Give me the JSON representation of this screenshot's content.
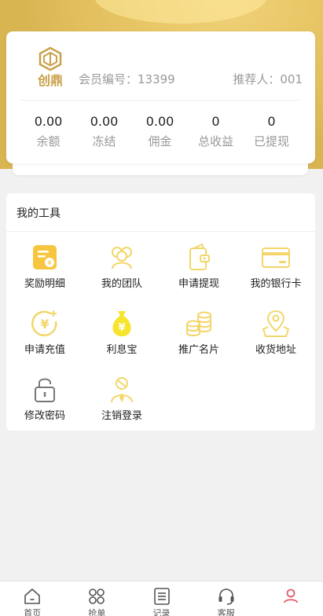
{
  "profile": {
    "logo_text": "创鼎",
    "member_id": "会员编号：13399",
    "referrer": "推荐人：001",
    "stats": [
      {
        "value": "0.00",
        "label": "余额"
      },
      {
        "value": "0.00",
        "label": "冻结"
      },
      {
        "value": "0.00",
        "label": "佣金"
      },
      {
        "value": "0",
        "label": "总收益"
      },
      {
        "value": "0",
        "label": "已提现"
      }
    ]
  },
  "tools": {
    "title": "我的工具",
    "items": [
      {
        "label": "奖励明细",
        "icon": "reward-detail-icon"
      },
      {
        "label": "我的团队",
        "icon": "team-icon"
      },
      {
        "label": "申请提现",
        "icon": "withdraw-wallet-icon"
      },
      {
        "label": "我的银行卡",
        "icon": "bank-card-icon"
      },
      {
        "label": "申请充值",
        "icon": "recharge-yen-icon"
      },
      {
        "label": "利息宝",
        "icon": "money-bag-icon"
      },
      {
        "label": "推广名片",
        "icon": "coins-stack-icon"
      },
      {
        "label": "收货地址",
        "icon": "map-pin-icon"
      },
      {
        "label": "修改密码",
        "icon": "padlock-icon"
      },
      {
        "label": "注销登录",
        "icon": "logout-user-icon"
      }
    ]
  },
  "tabbar": {
    "items": [
      {
        "label": "首页",
        "icon": "home-icon"
      },
      {
        "label": "抢单",
        "icon": "grab-order-icon"
      },
      {
        "label": "记录",
        "icon": "records-icon"
      },
      {
        "label": "客服",
        "icon": "headset-icon"
      },
      {
        "label": "",
        "icon": "user-icon"
      }
    ],
    "active_index": 4
  },
  "colors": {
    "brand_gold": "#e3bf5e",
    "icon_yellow": "#f6d43c",
    "active_pink": "#e25b6b"
  }
}
